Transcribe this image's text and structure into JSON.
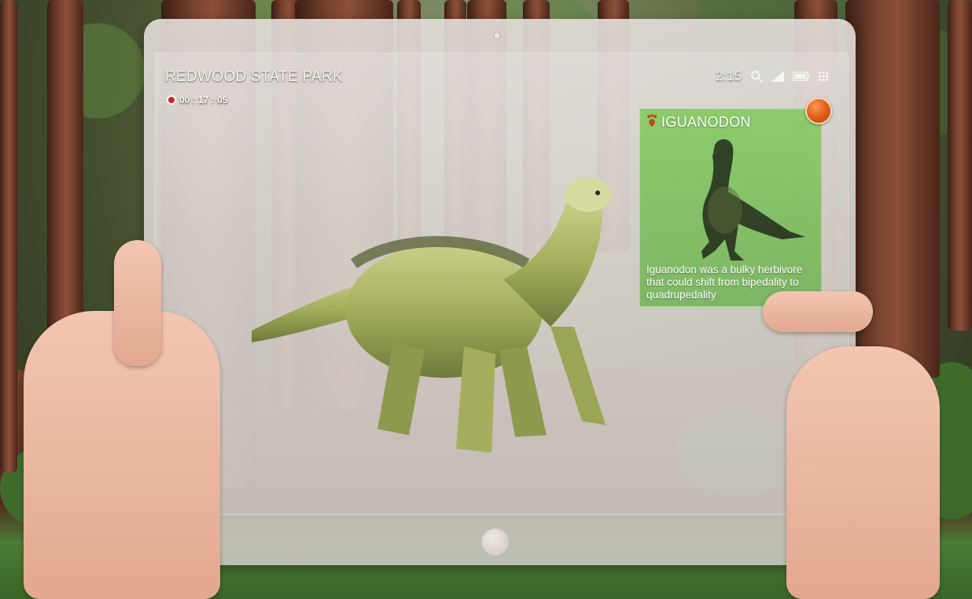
{
  "status_bar": {
    "title": "REDWOOD STATE PARK",
    "time": "2:15",
    "icons": [
      "search-icon",
      "signal-icon",
      "battery-icon",
      "grid-menu-icon"
    ]
  },
  "recording": {
    "time": "00 : 17 : 05",
    "indicator_color": "#e21d1d"
  },
  "info_card": {
    "title": "IGUANODON",
    "title_icon": "dinosaur-footprint-icon",
    "description": "Iguanodon was a bulky herbivore that could shift from bipedality to quadrupedality",
    "background_color": "#6fbf4a",
    "action_button_color": "#e2621c"
  },
  "colors": {
    "tablet_frame": "#dcd7d1",
    "text": "#f4f4f4"
  }
}
